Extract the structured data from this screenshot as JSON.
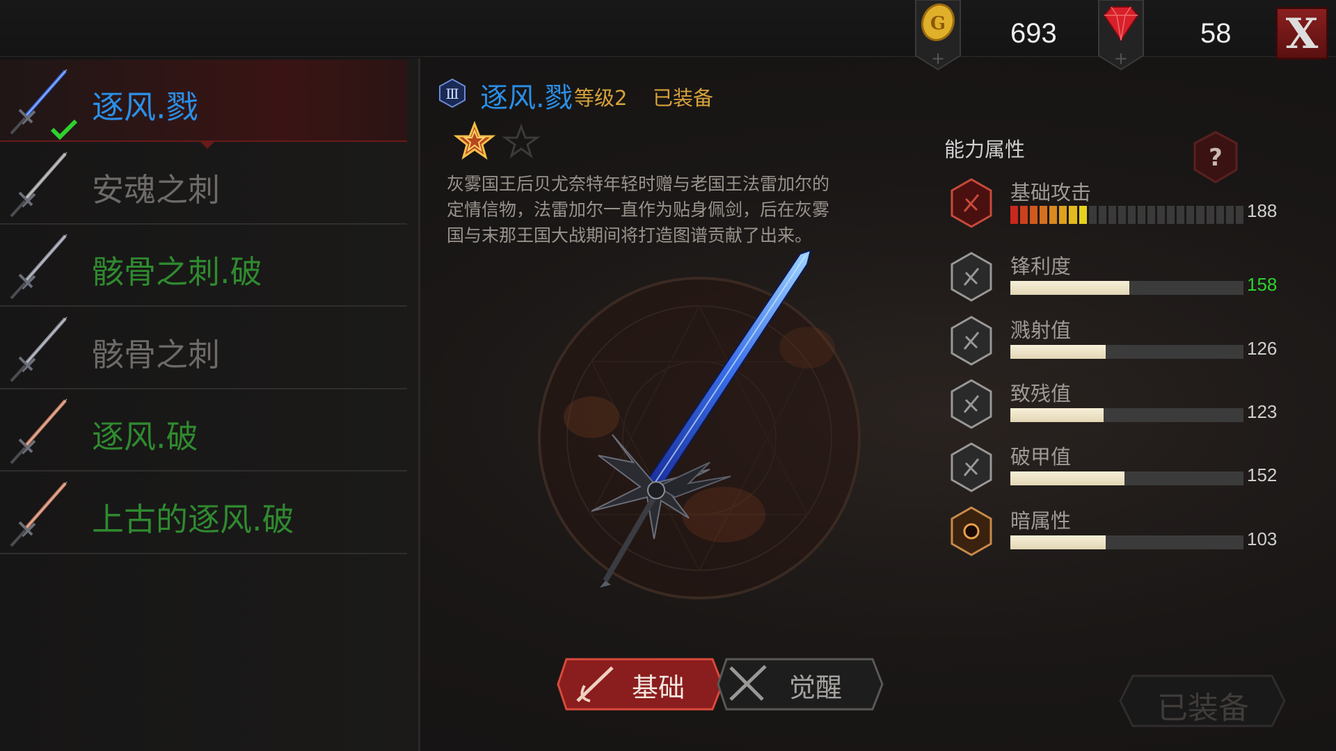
{
  "currency": {
    "gold": "693",
    "gems": "58",
    "gold_icon": "gold-coin-icon",
    "gem_icon": "ruby-gem-icon",
    "close_label": "X"
  },
  "weapon_list": [
    {
      "name": "逐风.戮",
      "color": "#2a8fe8",
      "selected": true,
      "equipped": true
    },
    {
      "name": "安魂之刺",
      "color": "#6d6a67",
      "selected": false,
      "equipped": false
    },
    {
      "name": "骸骨之刺.破",
      "color": "#2f8a2f",
      "selected": false,
      "equipped": false
    },
    {
      "name": "骸骨之刺",
      "color": "#6d6a67",
      "selected": false,
      "equipped": false
    },
    {
      "name": "逐风.破",
      "color": "#2f8a2f",
      "selected": false,
      "equipped": false
    },
    {
      "name": "上古的逐风.破",
      "color": "#2f8a2f",
      "selected": false,
      "equipped": false
    }
  ],
  "detail": {
    "tier_badge": "Ⅲ",
    "name": "逐风.戮",
    "level": "等级2",
    "status": "已装备",
    "stars_filled": 1,
    "stars_total": 2,
    "description": [
      "灰雾国王后贝尤奈特年轻时赠与老国王法雷加尔的",
      "定情信物，法雷加尔一直作为贴身佩剑，后在灰雾",
      "国与末那王国大战期间将打造图谱贡献了出来。"
    ]
  },
  "tabs": {
    "basic": "基础",
    "awaken": "觉醒"
  },
  "equip_button": "已装备",
  "attributes": {
    "title": "能力属性",
    "help": "?",
    "rows": [
      {
        "name": "基础攻击",
        "value": "188",
        "fill": 0.33,
        "segmented": true,
        "value_color": "#cfcfcf"
      },
      {
        "name": "锋利度",
        "value": "158",
        "fill": 0.51,
        "segmented": false,
        "value_color": "#2fd12f"
      },
      {
        "name": "溅射值",
        "value": "126",
        "fill": 0.41,
        "segmented": false,
        "value_color": "#cfcfcf"
      },
      {
        "name": "致残值",
        "value": "123",
        "fill": 0.4,
        "segmented": false,
        "value_color": "#cfcfcf"
      },
      {
        "name": "破甲值",
        "value": "152",
        "fill": 0.49,
        "segmented": false,
        "value_color": "#cfcfcf"
      },
      {
        "name": "暗属性",
        "value": "103",
        "fill": 0.41,
        "segmented": false,
        "value_color": "#cfcfcf"
      }
    ]
  }
}
